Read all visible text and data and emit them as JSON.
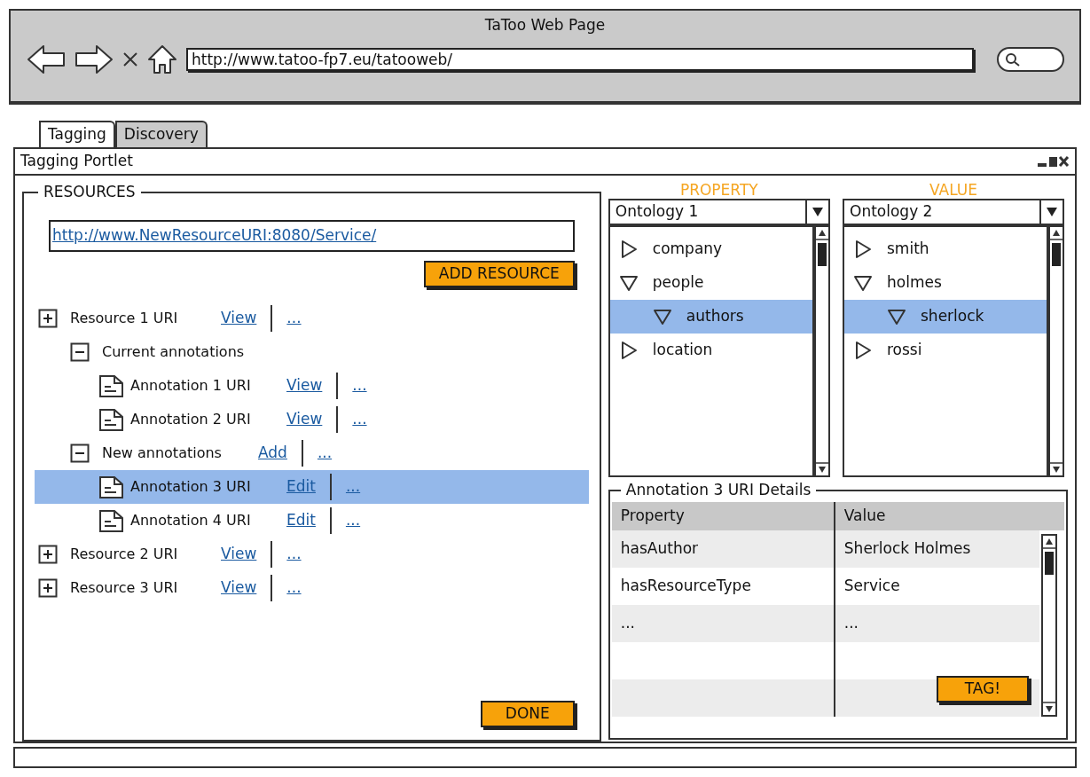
{
  "window": {
    "title": "TaToo Web Page",
    "address": "http://www.tatoo-fp7.eu/tatooweb/"
  },
  "tabs": [
    {
      "label": "Tagging",
      "selected": true
    },
    {
      "label": "Discovery",
      "selected": false
    }
  ],
  "portlet": {
    "title": "Tagging Portlet"
  },
  "resources": {
    "legend": "RESOURCES",
    "uri_field": {
      "value": "http://www.NewResourceURI:8080/Service/"
    },
    "add_button": "ADD RESOURCE",
    "done_button": "DONE",
    "tree": [
      {
        "kind": "resource",
        "label": "Resource 1 URI",
        "expanded": false,
        "selected": false,
        "actions": [
          "View",
          "..."
        ],
        "children": [
          {
            "kind": "group",
            "label": "Current annotations",
            "expanded": true,
            "selected": false,
            "children": [
              {
                "kind": "annotation",
                "label": "Annotation 1 URI",
                "selected": false,
                "actions": [
                  "View",
                  "..."
                ]
              },
              {
                "kind": "annotation",
                "label": "Annotation 2 URI",
                "selected": false,
                "actions": [
                  "View",
                  "..."
                ]
              }
            ]
          },
          {
            "kind": "group",
            "label": "New annotations",
            "expanded": true,
            "selected": false,
            "actions": [
              "Add",
              "..."
            ],
            "children": [
              {
                "kind": "annotation",
                "label": "Annotation 3 URI",
                "selected": true,
                "actions": [
                  "Edit",
                  "..."
                ]
              },
              {
                "kind": "annotation",
                "label": "Annotation 4 URI",
                "selected": false,
                "actions": [
                  "Edit",
                  "..."
                ]
              }
            ]
          }
        ]
      },
      {
        "kind": "resource",
        "label": "Resource 2 URI",
        "expanded": false,
        "selected": false,
        "actions": [
          "View",
          "..."
        ]
      },
      {
        "kind": "resource",
        "label": "Resource 3 URI",
        "expanded": false,
        "selected": false,
        "actions": [
          "View",
          "..."
        ]
      }
    ]
  },
  "ontology_panels": [
    {
      "header": "PROPERTY",
      "dropdown": "Ontology 1",
      "items": [
        {
          "label": "company",
          "expanded": false,
          "selected": false
        },
        {
          "label": "people",
          "expanded": true,
          "selected": false,
          "children": [
            {
              "label": "authors",
              "expanded": true,
              "selected": true
            }
          ]
        },
        {
          "label": "location",
          "expanded": false,
          "selected": false
        }
      ]
    },
    {
      "header": "VALUE",
      "dropdown": "Ontology 2",
      "items": [
        {
          "label": "smith",
          "expanded": false,
          "selected": false
        },
        {
          "label": "holmes",
          "expanded": true,
          "selected": false,
          "children": [
            {
              "label": "sherlock",
              "expanded": true,
              "selected": true
            }
          ]
        },
        {
          "label": "rossi",
          "expanded": false,
          "selected": false
        }
      ]
    }
  ],
  "details": {
    "legend": "Annotation 3 URI Details",
    "columns": [
      "Property",
      "Value"
    ],
    "rows": [
      [
        "hasAuthor",
        "Sherlock Holmes"
      ],
      [
        "hasResourceType",
        "Service"
      ],
      [
        "...",
        "..."
      ]
    ],
    "tag_button": "TAG!"
  }
}
